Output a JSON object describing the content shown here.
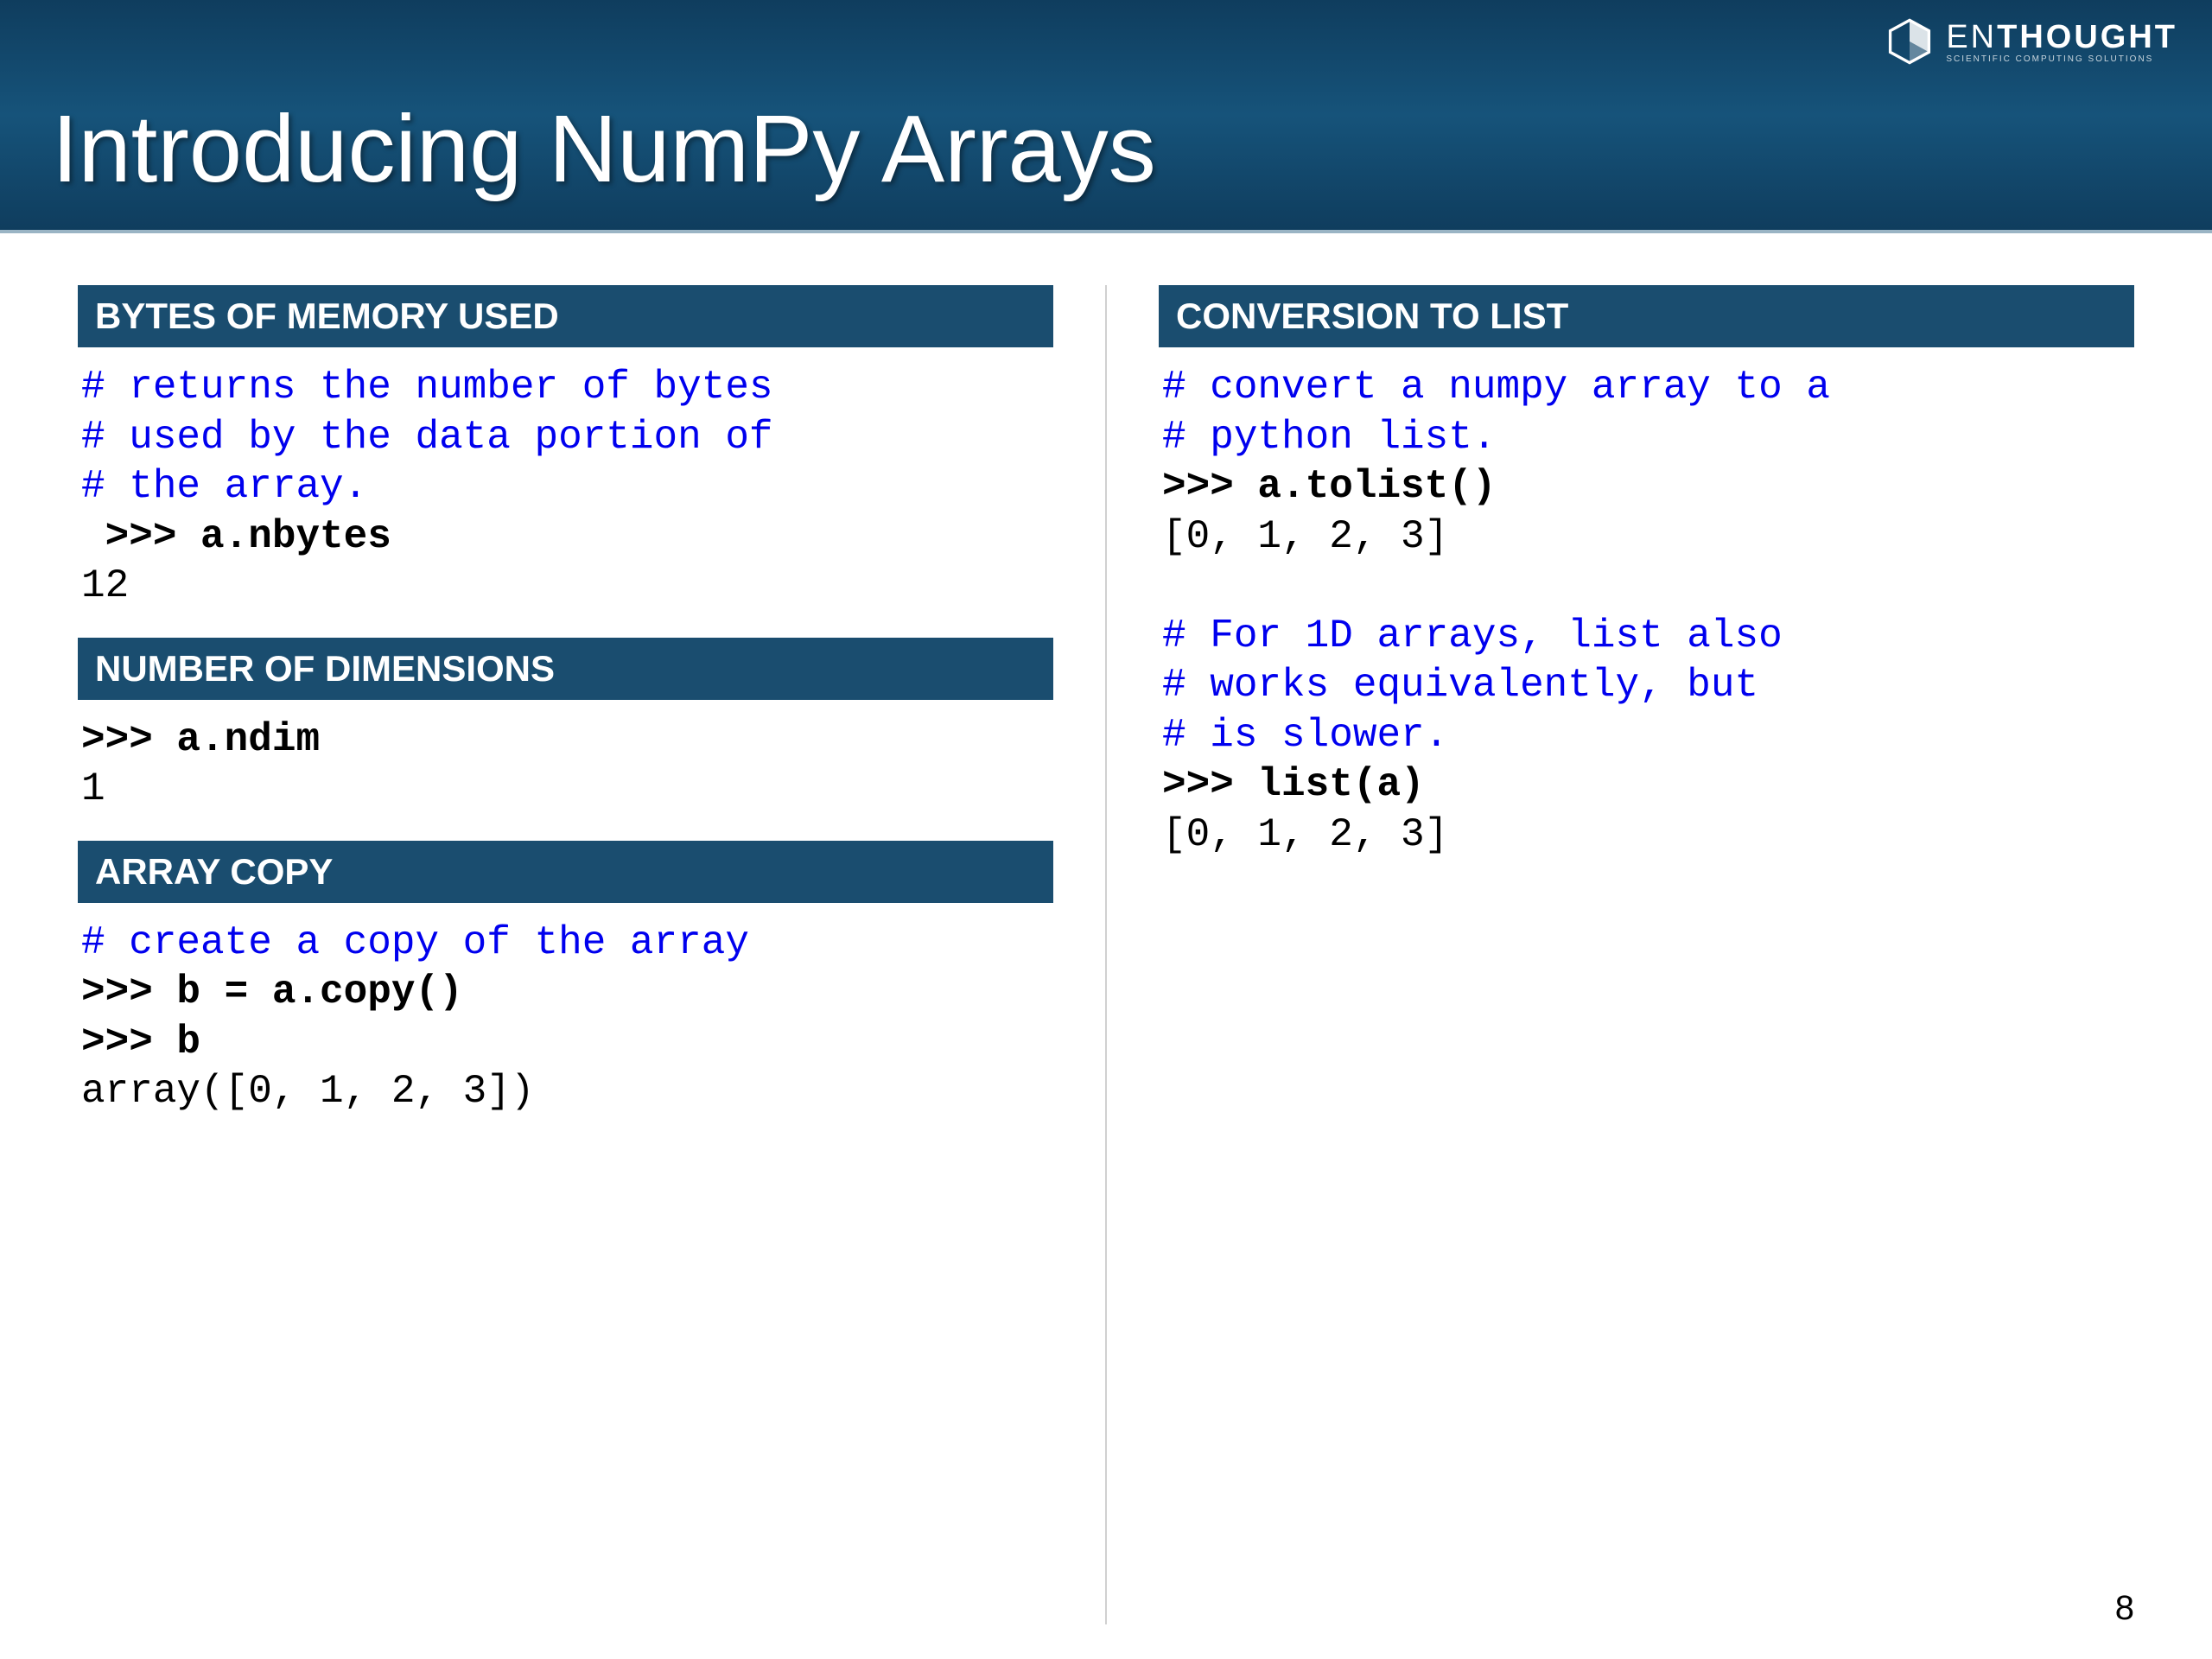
{
  "header": {
    "title": "Introducing NumPy Arrays",
    "brand_thin": "EN",
    "brand_bold": "THOUGHT",
    "brand_sub": "SCIENTIFIC COMPUTING SOLUTIONS"
  },
  "sections": {
    "bytes": {
      "heading": "BYTES OF MEMORY USED",
      "c1": "# returns the number of bytes",
      "c2": "# used by the data portion of",
      "c3": "# the array.",
      "in": " >>> a.nbytes",
      "out": "12"
    },
    "dims": {
      "heading": "NUMBER OF DIMENSIONS",
      "in": ">>> a.ndim",
      "out": "1"
    },
    "copy": {
      "heading": "ARRAY COPY",
      "c1": "# create a copy of the array",
      "in1": ">>> b = a.copy()",
      "in2": ">>> b",
      "out": "array([0, 1, 2, 3])"
    },
    "tolist": {
      "heading": "CONVERSION TO LIST",
      "c1": "# convert a numpy array to a",
      "c2": "# python list.",
      "in1": ">>> a.tolist()",
      "out1": "[0, 1, 2, 3]",
      "c3": "# For 1D arrays, list also",
      "c4": "# works equivalently, but",
      "c5": "# is slower.",
      "in2": ">>> list(a)",
      "out2": "[0, 1, 2, 3]"
    }
  },
  "page_number": "8"
}
